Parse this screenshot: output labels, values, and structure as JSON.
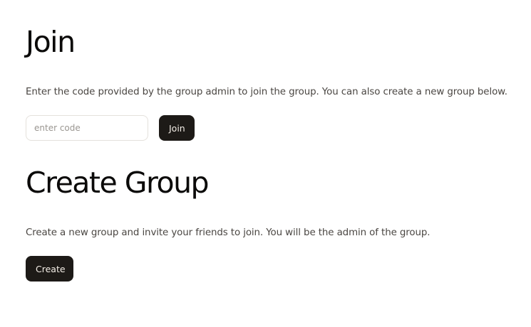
{
  "join": {
    "title": "Join",
    "description": "Enter the code provided by the group admin to join the group. You can also create a new group below.",
    "code_placeholder": "enter code",
    "code_value": "",
    "button_label": "Join"
  },
  "create": {
    "title": "Create Group",
    "description": "Create a new group and invite your friends to join. You will be the admin of the group.",
    "button_label": "Create"
  },
  "colors": {
    "button_bg": "#1d1a17",
    "button_text": "#f3ede6",
    "heading": "#0b0a09",
    "body_text": "#4a4642"
  }
}
